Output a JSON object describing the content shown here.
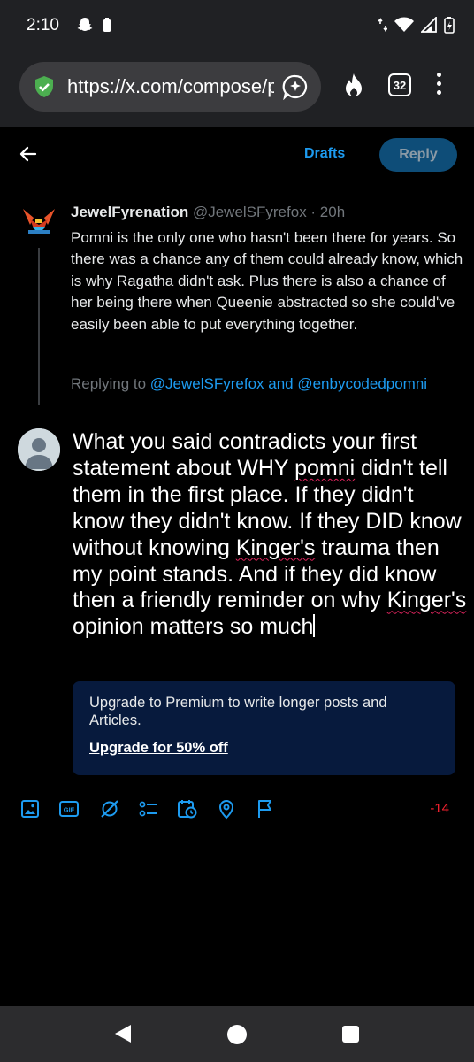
{
  "status_bar": {
    "time": "2:10",
    "icons": [
      "snapchat-icon",
      "battery-saver-icon",
      "data-arrows-icon",
      "wifi-icon",
      "signal-icon",
      "battery-icon"
    ]
  },
  "browser": {
    "url": "https://x.com/compose/post",
    "tab_count": "32",
    "icons": [
      "shield-check-icon",
      "share-icon",
      "fire-icon",
      "tabs-icon",
      "menu-icon"
    ]
  },
  "compose_header": {
    "drafts_label": "Drafts",
    "reply_label": "Reply"
  },
  "original_post": {
    "author_name": "JewelFyrenation",
    "handle_time": "@JewelSFyrefox · 20h",
    "text": "Pomni is the only one who hasn't been there for years. So there was a chance any of them could already know, which is why Ragatha didn't ask. Plus there is also a chance of her being there when Queenie abstracted so she could've easily been able to put everything together.",
    "replying_prefix": "Replying to ",
    "replying_mentions": "@JewelSFyrefox and @enbycodedpomni"
  },
  "compose": {
    "parts": [
      {
        "t": "What you said contradicts your first statement about WHY ",
        "sq": false
      },
      {
        "t": "pomni",
        "sq": true
      },
      {
        "t": " didn't tell them in the first place. If they didn't know they didn't know. If they DID know without knowing ",
        "sq": false
      },
      {
        "t": "Kinger's",
        "sq": true
      },
      {
        "t": " trauma then my point stands. And if they did know then a friendly reminder on why ",
        "sq": false
      },
      {
        "t": "Kinger's",
        "sq": true
      },
      {
        "t": " opinion matters so much",
        "sq": false
      }
    ]
  },
  "premium": {
    "text": "Upgrade to Premium to write longer posts and Articles.",
    "link": "Upgrade for 50% off"
  },
  "toolbar": {
    "char_count": "-14",
    "icons": [
      "image-icon",
      "gif-icon",
      "grok-icon",
      "poll-icon",
      "schedule-icon",
      "location-icon",
      "flag-icon"
    ]
  },
  "colors": {
    "accent": "#1d9bf0",
    "error": "#f4212e",
    "premium_bg": "#071a3d",
    "reply_disabled": "#0e4d78"
  }
}
